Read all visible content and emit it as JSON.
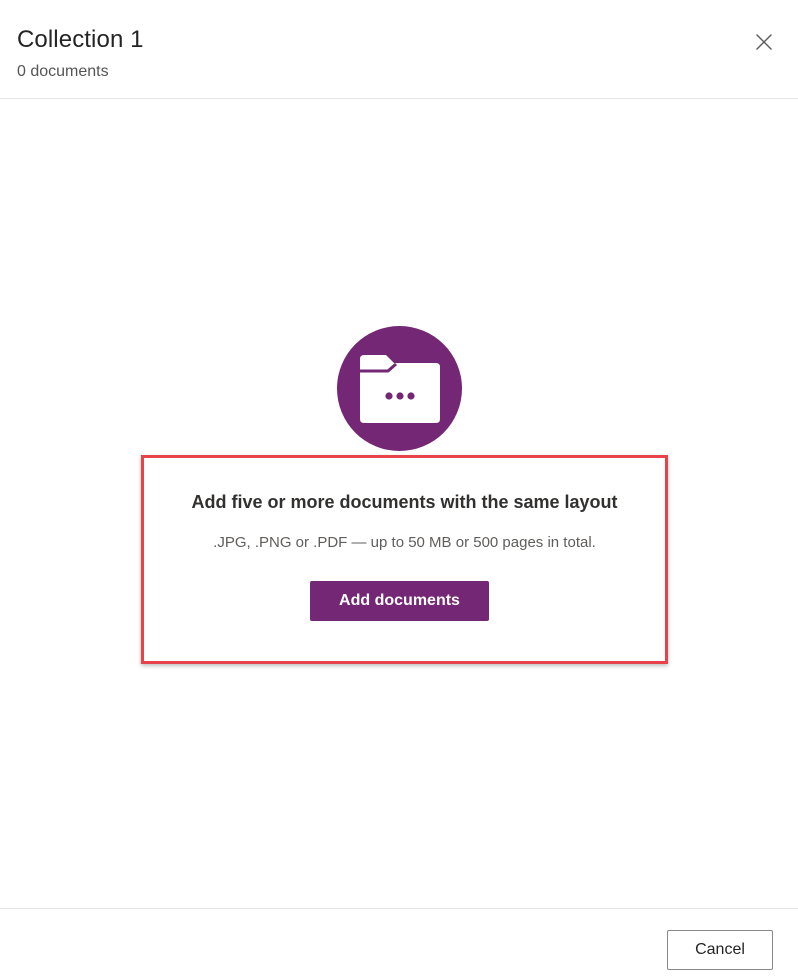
{
  "header": {
    "title": "Collection 1",
    "subtitle": "0 documents",
    "close_icon": "close-icon"
  },
  "empty_state": {
    "icon": "folder-icon",
    "heading": "Add five or more documents with the same layout",
    "description": ".JPG, .PNG or .PDF — up to 50 MB or 500 pages in total.",
    "add_button_label": "Add documents"
  },
  "footer": {
    "cancel_label": "Cancel"
  },
  "colors": {
    "accent": "#742774",
    "highlight": "#e8424b",
    "divider": "#e6e6e6"
  }
}
